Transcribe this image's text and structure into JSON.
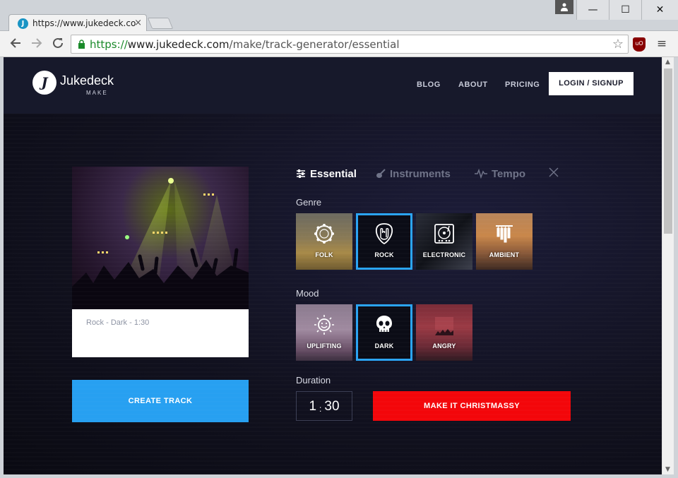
{
  "browser": {
    "tab_title": "https://www.jukedeck.com",
    "tab_close": "×",
    "url_scheme": "https://",
    "url_host": "www.jukedeck.com",
    "url_path": "/make/track-generator/essential",
    "win_min": "—",
    "win_max": "☐",
    "win_close": "✕",
    "ublock_label": "uO"
  },
  "header": {
    "logo_name": "Jukedeck",
    "logo_sub": "MAKE",
    "nav": {
      "blog": "BLOG",
      "about": "ABOUT",
      "pricing": "PRICING"
    },
    "login_label": "LOGIN / SIGNUP"
  },
  "track": {
    "caption": "Rock - Dark - 1:30",
    "create_label": "CREATE TRACK"
  },
  "panel": {
    "tabs": {
      "essential": "Essential",
      "instruments": "Instruments",
      "tempo": "Tempo"
    },
    "genre_label": "Genre",
    "mood_label": "Mood",
    "duration_label": "Duration",
    "genres": [
      "FOLK",
      "ROCK",
      "ELECTRONIC",
      "AMBIENT"
    ],
    "moods": [
      "UPLIFTING",
      "DARK",
      "ANGRY"
    ],
    "selected_genre": "ROCK",
    "selected_mood": "DARK",
    "duration_min": "1",
    "duration_sep": ":",
    "duration_sec": "30",
    "xmas_label": "MAKE IT CHRISTMASSY"
  },
  "colors": {
    "accent_blue": "#27a0f1",
    "christmas_red": "#f3060a",
    "header_bg": "#17192b"
  }
}
